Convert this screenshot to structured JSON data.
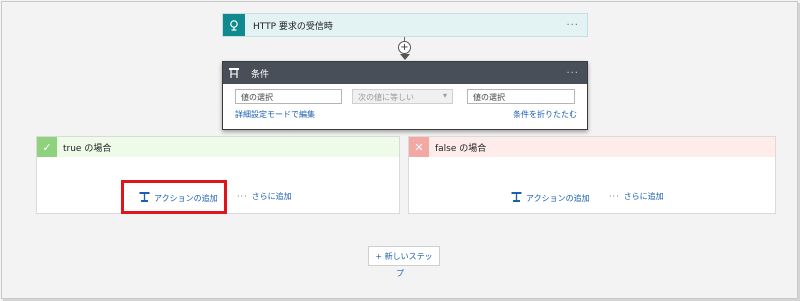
{
  "trigger": {
    "title": "HTTP 要求の受信時",
    "menu": "···",
    "icon": "http-request-icon"
  },
  "connector": {
    "plus": "+"
  },
  "condition": {
    "title": "条件",
    "menu": "···",
    "icon": "condition-icon",
    "left_value_placeholder": "値の選択",
    "operator": "次の値に等しい",
    "right_value_placeholder": "値の選択",
    "advanced_link": "詳細設定モードで編集",
    "collapse_link": "条件を折りたたむ"
  },
  "branches": {
    "true": {
      "title": "true の場合",
      "add_action": "アクションの追加",
      "more": "さらに追加",
      "more_dots": "···",
      "color": "#8fd27d"
    },
    "false": {
      "title": "false の場合",
      "add_action": "アクションの追加",
      "more": "さらに追加",
      "more_dots": "···",
      "color": "#f3a8a4"
    }
  },
  "new_step": {
    "label": "+ 新しいステッ",
    "label_wrap": "プ"
  },
  "colors": {
    "accent": "#1a5fb4",
    "highlight": "#e0151b",
    "trigger": "#0f8a8f",
    "condition_header": "#484f58"
  }
}
